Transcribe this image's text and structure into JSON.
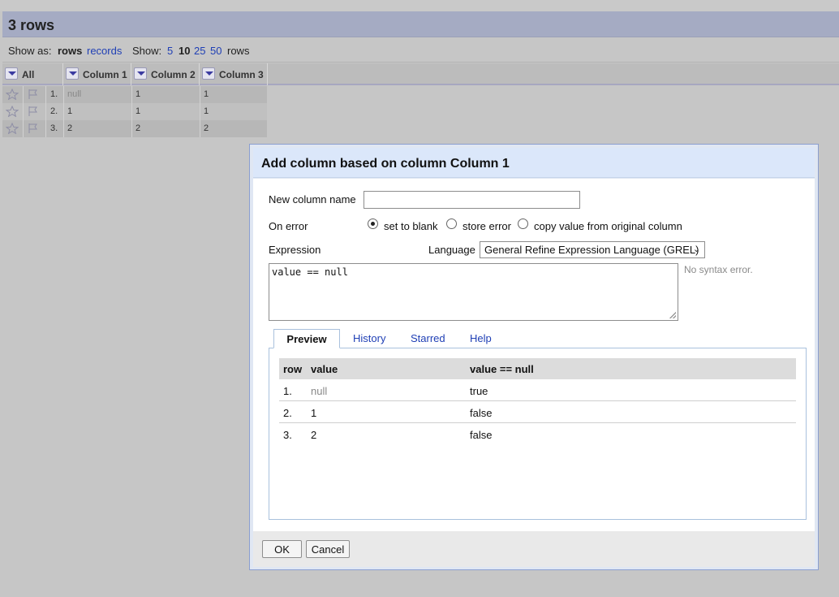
{
  "header": {
    "row_count": "3 rows"
  },
  "view_bar": {
    "show_as_label": "Show as:",
    "rows": "rows",
    "records": "records",
    "show_label": "Show:",
    "page_sizes": [
      "5",
      "10",
      "25",
      "50"
    ],
    "selected_page_size": "10",
    "rows_suffix": "rows"
  },
  "grid": {
    "all_label": "All",
    "columns": [
      "Column 1",
      "Column 2",
      "Column 3"
    ],
    "rows": [
      {
        "index": "1.",
        "c1": "null",
        "c2": "1",
        "c3": "1"
      },
      {
        "index": "2.",
        "c1": "1",
        "c2": "1",
        "c3": "1"
      },
      {
        "index": "3.",
        "c1": "2",
        "c2": "2",
        "c3": "2"
      }
    ]
  },
  "dialog": {
    "title": "Add column based on column Column 1",
    "new_column_label": "New column name",
    "new_column_value": "",
    "on_error_label": "On error",
    "on_error_options": [
      "set to blank",
      "store error",
      "copy value from original column"
    ],
    "on_error_selected": "set to blank",
    "expression_label": "Expression",
    "language_label": "Language",
    "language_value": "General Refine Expression Language (GREL)",
    "expression": "value == null",
    "syntax_status": "No syntax error.",
    "tabs": [
      "Preview",
      "History",
      "Starred",
      "Help"
    ],
    "active_tab": "Preview",
    "preview": {
      "headers": [
        "row",
        "value",
        "value == null"
      ],
      "rows": [
        {
          "row": "1.",
          "value": "null",
          "result": "true"
        },
        {
          "row": "2.",
          "value": "1",
          "result": "false"
        },
        {
          "row": "3.",
          "value": "2",
          "result": "false"
        }
      ]
    },
    "buttons": {
      "ok": "OK",
      "cancel": "Cancel"
    }
  },
  "colors": {
    "link": "#1f3fb5",
    "header_bar": "#a5abc3",
    "dialog_title_bg": "#dbe7fa"
  }
}
